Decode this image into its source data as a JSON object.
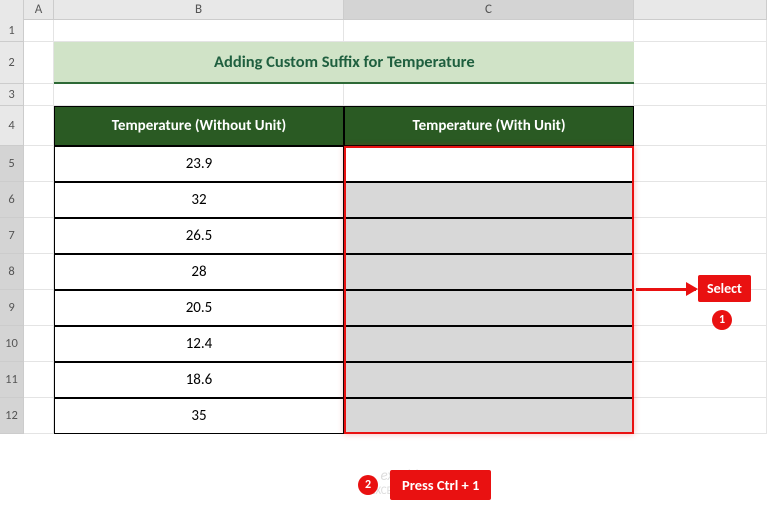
{
  "columns": {
    "a": "A",
    "b": "B",
    "c": "C"
  },
  "row_labels": [
    "1",
    "2",
    "3",
    "4",
    "5",
    "6",
    "7",
    "8",
    "9",
    "10",
    "11",
    "12"
  ],
  "title": "Adding Custom Suffix for Temperature",
  "headers": {
    "without": "Temperature (Without Unit)",
    "with": "Temperature (With Unit)"
  },
  "data": {
    "values": [
      "23.9",
      "32",
      "26.5",
      "28",
      "20.5",
      "12.4",
      "18.6",
      "35"
    ]
  },
  "callouts": {
    "select": "Select",
    "badge1": "1",
    "badge2": "2",
    "press": "Press Ctrl + 1"
  },
  "watermark": {
    "brand": "exceldemy",
    "tag": "EXCEL · DATA · TIPS"
  }
}
